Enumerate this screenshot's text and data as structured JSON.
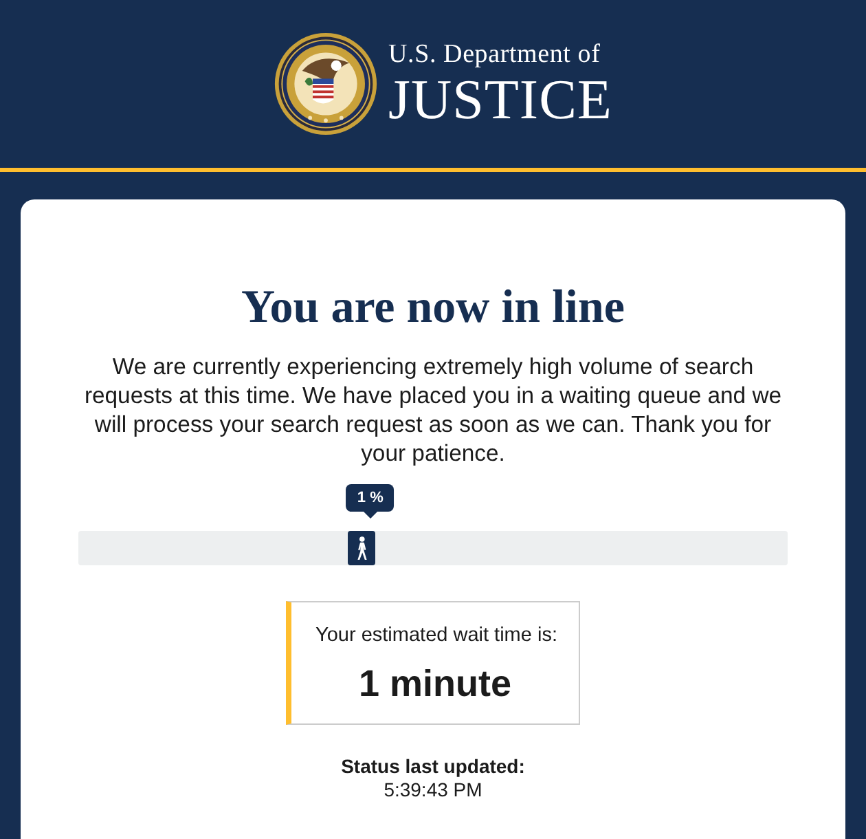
{
  "header": {
    "agency_line": "U.S. Department of",
    "agency_name": "JUSTICE"
  },
  "queue": {
    "title": "You are now in line",
    "message": "We are currently experiencing extremely high volume of search requests at this time. We have placed you in a waiting queue and we will process your search request as soon as we can. Thank you for your patience.",
    "progress": {
      "reading": "1 %",
      "level": 0.4
    },
    "wait": {
      "label": "Your estimated wait time is:",
      "value": "1 minute"
    },
    "status": {
      "label": "Status last updated:",
      "time": "5:39:43 PM"
    }
  }
}
